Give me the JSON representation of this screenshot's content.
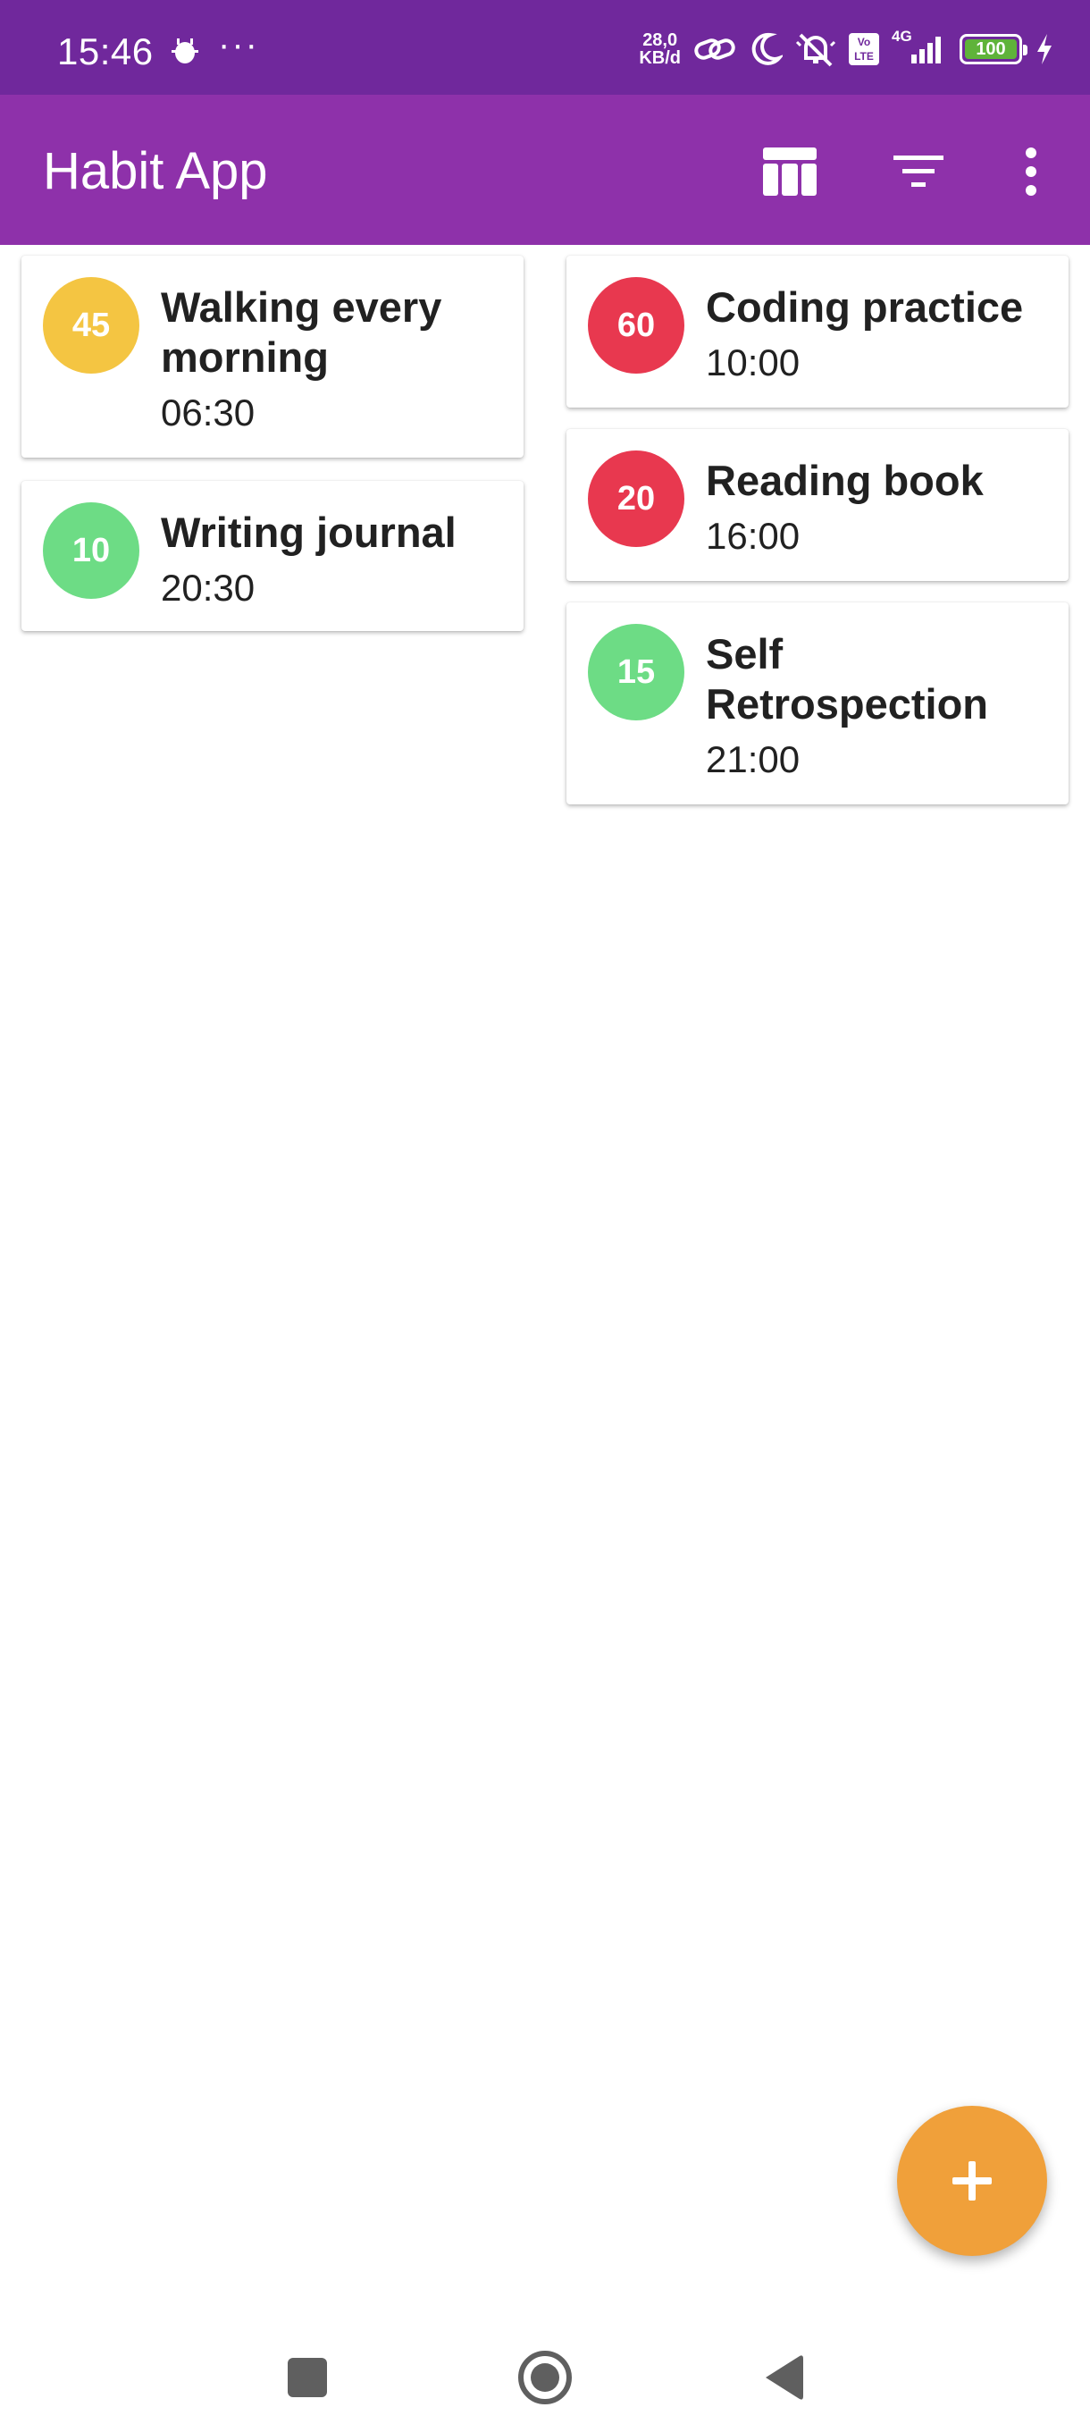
{
  "status_bar": {
    "time": "15:46",
    "dots": "···",
    "speed_top": "28,0",
    "speed_bottom": "KB/d",
    "volte": "Vo LTE",
    "network": "4G",
    "battery": "100",
    "icons": [
      "bug-notification-icon",
      "link-icon",
      "moon-icon",
      "mute-icon",
      "volte-icon",
      "signal-icon",
      "battery-icon",
      "charging-icon"
    ]
  },
  "app_bar": {
    "title": "Habit App",
    "actions": [
      "table-view-icon",
      "filter-icon",
      "more-vert-icon"
    ]
  },
  "habits": [
    {
      "title": "Walking every morning",
      "time": "06:30",
      "score": "45",
      "color": "#f4c542"
    },
    {
      "title": "Writing journal",
      "time": "20:30",
      "score": "10",
      "color": "#6ddc85"
    },
    {
      "title": "Coding practice",
      "time": "10:00",
      "score": "60",
      "color": "#e8384f"
    },
    {
      "title": "Reading book",
      "time": "16:00",
      "score": "20",
      "color": "#e8384f"
    },
    {
      "title": "Self Retrospection",
      "time": "21:00",
      "score": "15",
      "color": "#6ddc85"
    }
  ],
  "fab": {
    "icon": "plus-icon",
    "color": "#f0a03a"
  },
  "nav_bar": {
    "icons": [
      "recents-square-icon",
      "home-circle-icon",
      "back-triangle-icon"
    ]
  }
}
